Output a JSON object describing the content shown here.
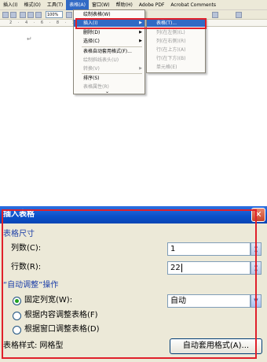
{
  "menubar": {
    "items": [
      "插入(I)",
      "格式(O)",
      "工具(T)",
      "表格(A)",
      "窗口(W)",
      "帮助(H)",
      "Adobe PDF",
      "Acrobat Comments"
    ],
    "active_index": 3
  },
  "toolbar": {
    "zoom": "100%"
  },
  "ruler": {
    "ticks": "2 · 4 · 6 · 8 · 10"
  },
  "table_menu": {
    "items": [
      {
        "label": "绘制表格(W)",
        "disabled": false
      },
      {
        "label": "插入(I)",
        "submenu": true,
        "selected": true
      },
      {
        "label": "删除(D)",
        "submenu": true
      },
      {
        "label": "选择(C)",
        "submenu": true
      },
      {
        "label": "表格自动套用格式(F)...",
        "disabled": false
      },
      {
        "label": "绘制斜线表头(U)",
        "disabled": true
      },
      {
        "label": "转换(V)",
        "submenu": true,
        "disabled": true
      },
      {
        "label": "排序(S)",
        "disabled": false
      },
      {
        "label": "表格属性(R)",
        "disabled": true
      }
    ],
    "more": "⌄"
  },
  "insert_submenu": {
    "items": [
      {
        "label": "表格(T)...",
        "selected": true
      },
      {
        "label": "列(在左侧)(L)",
        "disabled": true
      },
      {
        "label": "列(在右侧)(R)",
        "disabled": true
      },
      {
        "label": "行(在上方)(A)",
        "disabled": true
      },
      {
        "label": "行(在下方)(B)",
        "disabled": true
      },
      {
        "label": "单元格(E)",
        "disabled": true
      }
    ]
  },
  "dialog": {
    "title": "插入表格",
    "close_glyph": "✕",
    "size_group": "表格尺寸",
    "columns_label": "列数(C):",
    "columns_value": "1",
    "rows_label": "行数(R):",
    "rows_value": "22",
    "autofit_group": "“自动调整”操作",
    "options": [
      {
        "label": "固定列宽(W):",
        "checked": true
      },
      {
        "label": "根据内容调整表格(F)",
        "checked": false
      },
      {
        "label": "根据窗口调整表格(D)",
        "checked": false
      }
    ],
    "col_width_value": "自动",
    "table_style_label": "表格样式: 网格型",
    "autoformat_button": "自动套用格式(A)..."
  },
  "colors": {
    "highlight": "#e0202a",
    "title_bar": "#0a4fc8",
    "menu_selected": "#316ac5"
  }
}
